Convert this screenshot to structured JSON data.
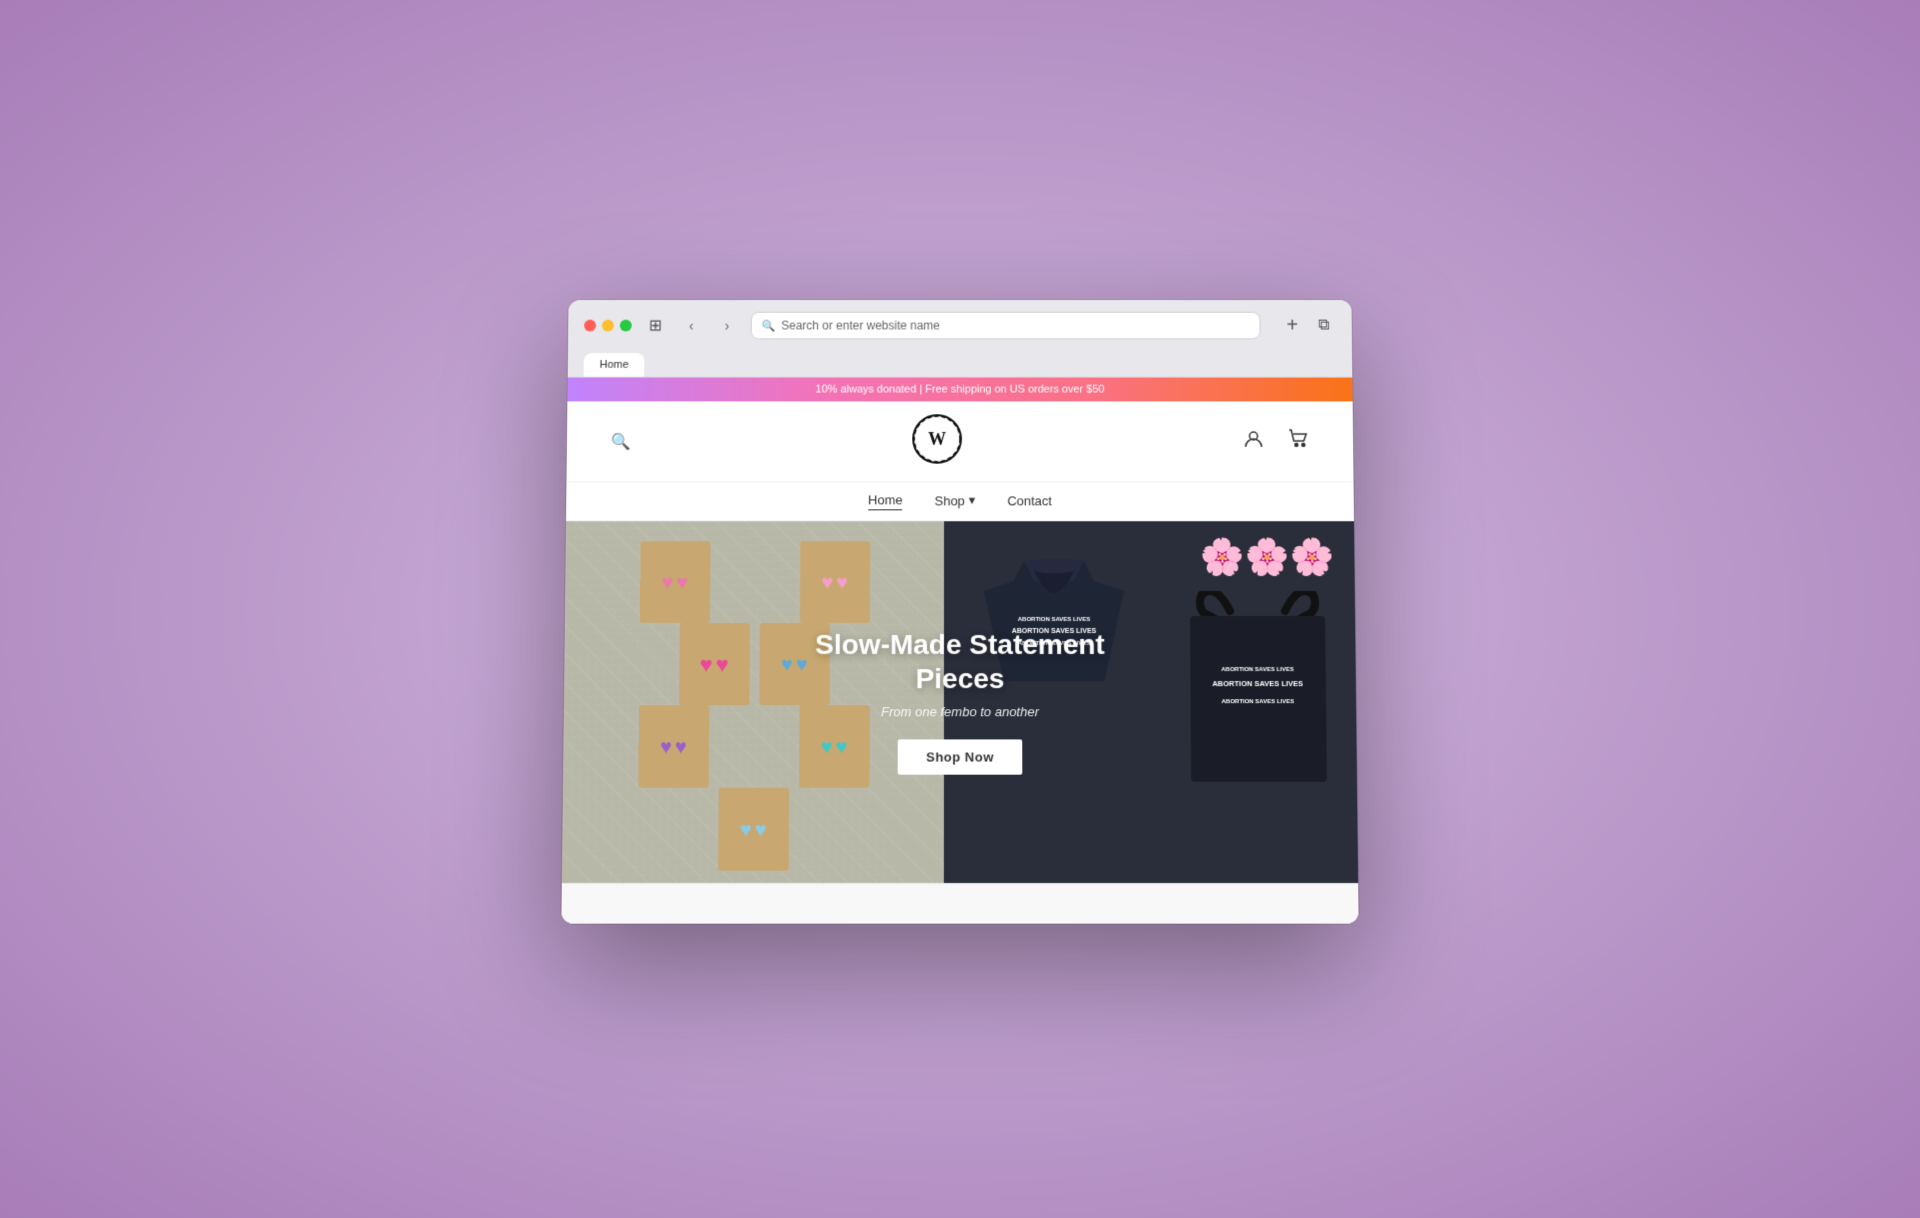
{
  "browser": {
    "address_placeholder": "Search or enter website name",
    "tab_label": "Home"
  },
  "announcement_bar": {
    "text": "10% always donated | Free shipping on US orders over $50"
  },
  "header": {
    "logo_text": "🌀",
    "logo_alt": "Wrangle Co"
  },
  "nav": {
    "items": [
      {
        "label": "Home",
        "active": true
      },
      {
        "label": "Shop",
        "has_dropdown": true
      },
      {
        "label": "Contact",
        "has_dropdown": false
      }
    ]
  },
  "hero": {
    "title": "Slow-Made Statement Pieces",
    "subtitle": "From one fembo to another",
    "cta_label": "Shop Now"
  },
  "tote_text_lines": [
    "ABORTION SAVES LIVES",
    "ABORTION SAVES LIVES",
    "ABORTION SAVES LIVES"
  ],
  "icons": {
    "search": "🔍",
    "account": "👤",
    "cart": "🛍",
    "chevron_down": "▾",
    "back": "‹",
    "forward": "›",
    "sidebar": "⊞",
    "new_tab": "+",
    "copy_tab": "⧉"
  }
}
